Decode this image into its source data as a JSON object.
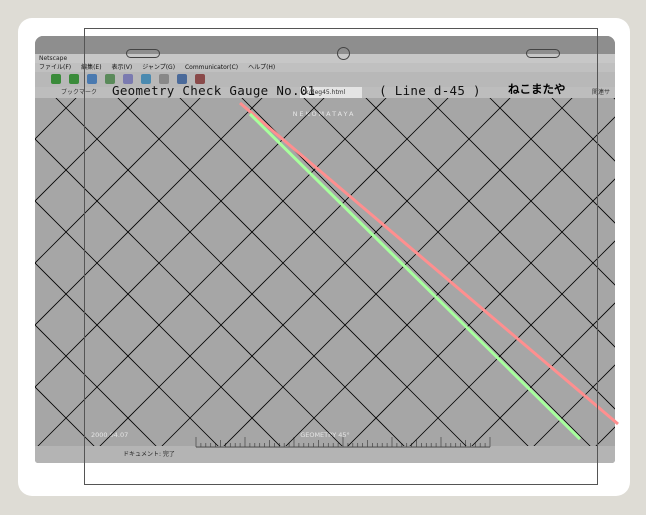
{
  "overlay_title": "Geometry Check Gauge No.01",
  "overlay_subtitle": "( Line d-45 )",
  "overlay_logo": "ねこまたや",
  "browser": {
    "window_title": "Netscape",
    "menu": [
      "ファイル(F)",
      "編集(E)",
      "表示(V)",
      "ジャンプ(G)",
      "Communicator(C)",
      "ヘルプ(H)"
    ],
    "bookmark_label": "ブックマーク",
    "location_text": "ck/deg45.html",
    "related_label": "関連サイ",
    "status_text": "ドキュメント: 完了"
  },
  "page": {
    "brand": "NEKOMATAYA",
    "date": "2000.04.07",
    "caption": "GEOMETRY 45°"
  },
  "colors": {
    "background": "#dedcd5",
    "grid_line": "#000000",
    "red_line": "#ff8f8f",
    "green_line": "#a7ff9d"
  }
}
